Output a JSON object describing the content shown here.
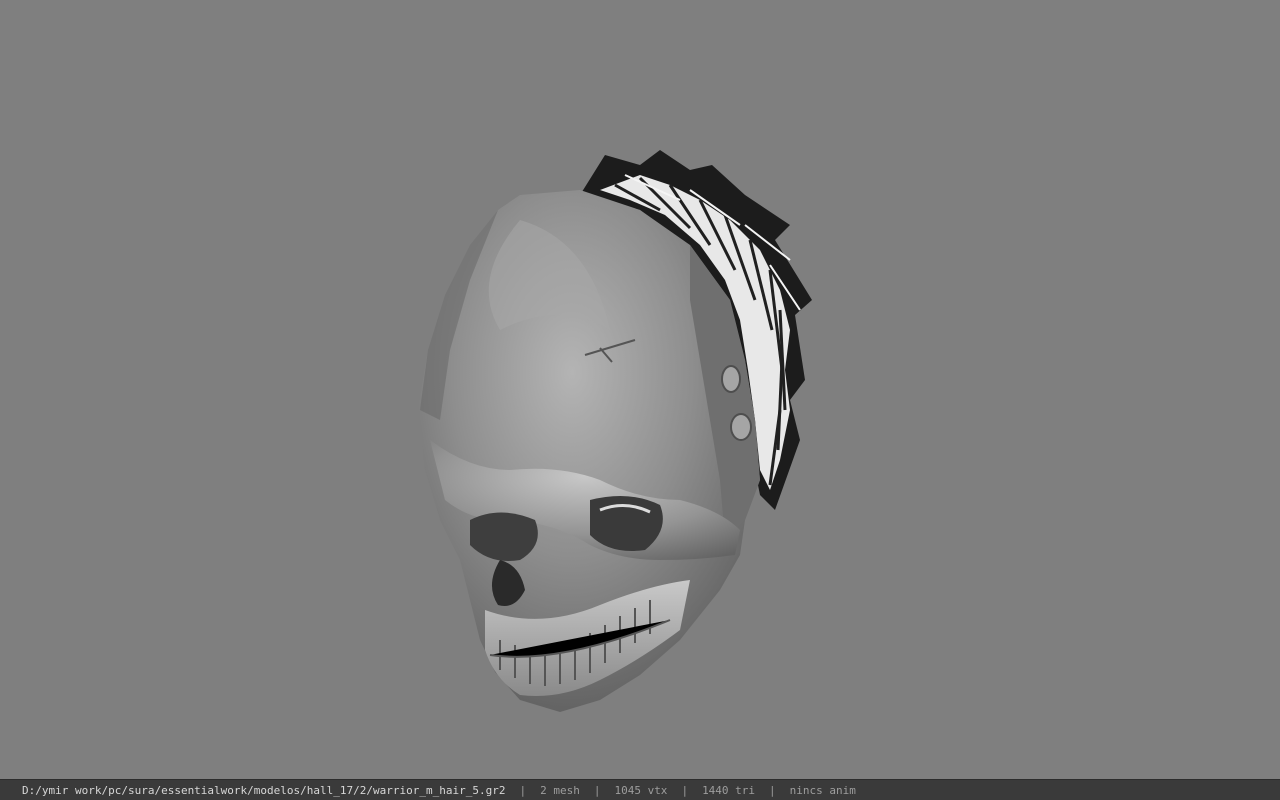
{
  "viewport": {
    "background": "#7f7f7f",
    "model_subject": "skull helmet with feather crest"
  },
  "statusbar": {
    "file_path": "D:/ymir work/pc/sura/essentialwork/modelos/hall_17/2/warrior_m_hair_5.gr2",
    "separator": "|",
    "mesh": "2 mesh",
    "vertices": "1045 vtx",
    "triangles": "1440 tri",
    "animation": "nincs anim"
  }
}
